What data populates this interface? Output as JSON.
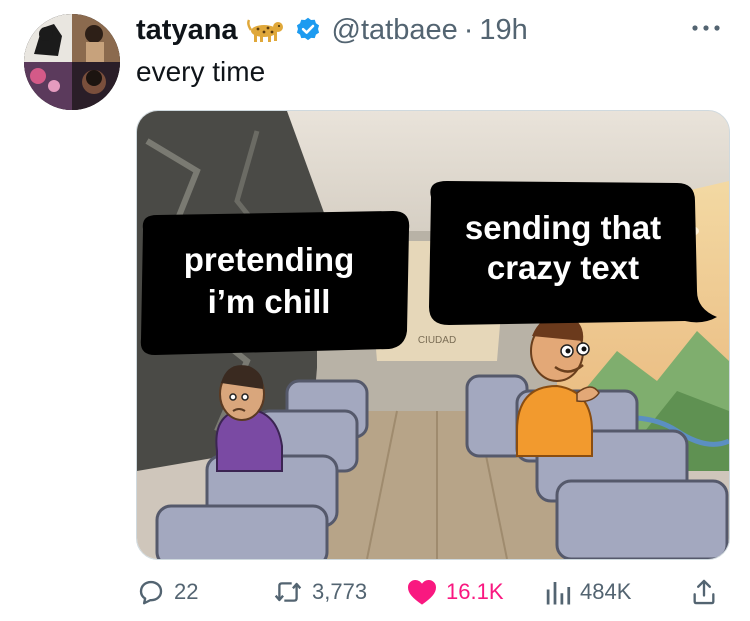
{
  "tweet": {
    "display_name": "tatyana",
    "name_emoji": "leopard-emoji",
    "verified": true,
    "handle": "@tatbaee",
    "separator": "·",
    "timestamp": "19h",
    "text": "every time",
    "meme": {
      "left_caption_line1": "pretending",
      "left_caption_line2": "i’m chill",
      "right_caption_line1": "sending that",
      "right_caption_line2": "crazy text"
    },
    "stats": {
      "replies": "22",
      "reposts": "3,773",
      "likes": "16.1K",
      "views": "484K"
    }
  },
  "colors": {
    "text_primary": "#0f1419",
    "text_secondary": "#536471",
    "verified_blue": "#1d9bf0",
    "like_pink": "#f91880"
  },
  "icons": [
    "more-icon",
    "verified-badge-icon",
    "reply-icon",
    "repost-icon",
    "like-icon",
    "views-icon",
    "share-icon"
  ]
}
